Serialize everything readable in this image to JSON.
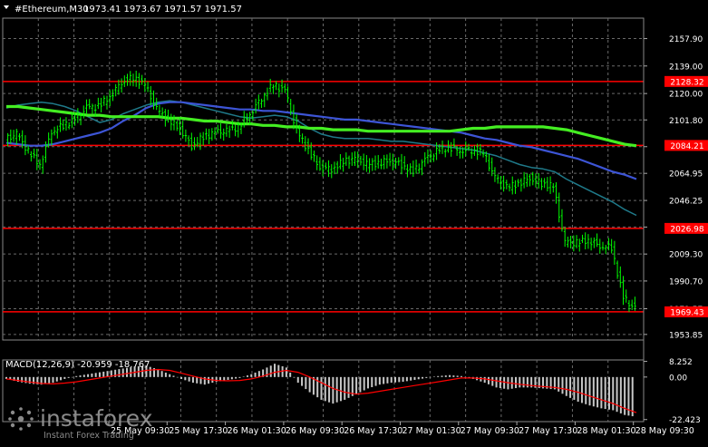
{
  "header": {
    "symbol": "#Ethereum,M30",
    "ohlc": "1973.41 1973.67 1971.57 1971.57"
  },
  "macd": {
    "label": "MACD(12,26,9) -20.959 -18.767",
    "axis_ticks": [
      "8.252",
      "0.00",
      "-22.423"
    ]
  },
  "watermark": {
    "brand": "instaforex",
    "tagline": "Instant Forex Trading"
  },
  "colors": {
    "background": "#000000",
    "grid": "#6a6a6a",
    "candle": "#00ff00",
    "level": "#ff0000",
    "ma_fast": "#1f7a8a",
    "ma_mid": "#3d55d6",
    "ma_slow": "#44ee22",
    "hist": "#c8c8c8",
    "signal": "#ff0000"
  },
  "chart_data": {
    "type": "line",
    "ylim": [
      1950.0,
      2172.0
    ],
    "y_ticks": [
      2157.9,
      2139.0,
      2120.0,
      2101.8,
      2083.35,
      2064.95,
      2046.25,
      2027.9,
      2009.3,
      1990.7,
      1971.57,
      1953.85
    ],
    "x_tick_labels": [
      "25 May 09:30",
      "25 May 17:30",
      "26 May 01:30",
      "26 May 09:30",
      "26 May 17:30",
      "27 May 01:30",
      "27 May 09:30",
      "27 May 17:30",
      "28 May 01:30",
      "28 May 09:30"
    ],
    "price_levels": [
      2128.32,
      2084.21,
      2026.98,
      1969.43
    ],
    "series": [
      {
        "values": [
          2088,
          2092,
          2080,
          2071,
          2094,
          2098,
          2102,
          2110,
          2111,
          2118,
          2128,
          2131,
          2126,
          2109,
          2102,
          2096,
          2084,
          2090,
          2093,
          2094,
          2097,
          2106,
          2117,
          2126,
          2122,
          2094,
          2081,
          2069,
          2068,
          2073,
          2075,
          2071,
          2072,
          2074,
          2071,
          2066,
          2074,
          2080,
          2083,
          2081,
          2081,
          2079,
          2062,
          2055,
          2058,
          2062,
          2058,
          2056,
          2017,
          2017,
          2019,
          2015,
          2014,
          1979,
          1971.57
        ]
      },
      {
        "values": [
          2110,
          2112,
          2113,
          2114,
          2113,
          2111,
          2108,
          2104,
          2100,
          2102,
          2106,
          2109,
          2112,
          2114,
          2115,
          2114,
          2112,
          2110,
          2108,
          2106,
          2104,
          2103,
          2104,
          2105,
          2104,
          2101,
          2096,
          2092,
          2090,
          2089,
          2089,
          2089,
          2088,
          2087,
          2087,
          2086,
          2085,
          2084,
          2083,
          2082,
          2081,
          2079,
          2077,
          2074,
          2071,
          2069,
          2068,
          2066,
          2061,
          2057,
          2053,
          2049,
          2045,
          2040,
          2036
        ]
      },
      {
        "values": [
          2086,
          2085,
          2084,
          2084,
          2085,
          2087,
          2089,
          2091,
          2093,
          2096,
          2101,
          2105,
          2110,
          2113,
          2114,
          2114,
          2113,
          2112,
          2111,
          2110,
          2109,
          2109,
          2108,
          2108,
          2107,
          2106,
          2105,
          2104,
          2103,
          2102,
          2102,
          2101,
          2100,
          2099,
          2098,
          2097,
          2096,
          2095,
          2094,
          2093,
          2091,
          2089,
          2088,
          2086,
          2084,
          2083,
          2081,
          2079,
          2077,
          2075,
          2072,
          2069,
          2066,
          2064,
          2061
        ]
      },
      {
        "values": [
          2111,
          2111,
          2110,
          2109,
          2108,
          2107,
          2106,
          2105,
          2105,
          2104,
          2104,
          2104,
          2104,
          2104,
          2103,
          2103,
          2102,
          2101,
          2101,
          2100,
          2099,
          2099,
          2098,
          2098,
          2097,
          2097,
          2096,
          2096,
          2095,
          2095,
          2095,
          2094,
          2094,
          2094,
          2094,
          2094,
          2094,
          2094,
          2094,
          2095,
          2096,
          2096,
          2097,
          2097,
          2097,
          2097,
          2097,
          2096,
          2095,
          2093,
          2091,
          2089,
          2087,
          2085,
          2084
        ]
      }
    ],
    "macd": {
      "ylim": [
        -23.5,
        9.0
      ],
      "histogram": [
        -1.0,
        -2.5,
        -3.5,
        -4.0,
        -3.0,
        -1.0,
        0.5,
        1.5,
        2.5,
        3.5,
        4.5,
        5.5,
        6.0,
        4.0,
        1.5,
        -1.0,
        -3.0,
        -4.0,
        -2.5,
        -1.5,
        -0.5,
        1.5,
        4.0,
        7.0,
        5.0,
        -3.0,
        -8.0,
        -12.0,
        -14.0,
        -12.0,
        -9.0,
        -6.0,
        -4.0,
        -3.0,
        -2.5,
        -1.5,
        -0.5,
        0.5,
        1.0,
        0.5,
        -1.0,
        -3.0,
        -5.5,
        -6.5,
        -5.5,
        -5.5,
        -6.0,
        -6.5,
        -10.0,
        -13.0,
        -15.0,
        -16.5,
        -17.5,
        -20.0,
        -21.0
      ],
      "signal": [
        -1.0,
        -1.8,
        -2.6,
        -3.4,
        -3.6,
        -3.2,
        -2.5,
        -1.5,
        -0.5,
        0.5,
        1.5,
        2.5,
        3.5,
        4.0,
        3.5,
        2.0,
        0.5,
        -1.0,
        -1.8,
        -2.0,
        -1.8,
        -1.0,
        0.5,
        2.5,
        3.5,
        2.5,
        0.0,
        -3.0,
        -6.0,
        -8.0,
        -9.0,
        -8.5,
        -7.5,
        -6.5,
        -5.5,
        -4.5,
        -3.5,
        -2.5,
        -1.5,
        -0.5,
        -0.5,
        -1.0,
        -2.0,
        -3.0,
        -3.8,
        -4.5,
        -5.0,
        -5.5,
        -6.5,
        -8.0,
        -10.0,
        -12.0,
        -14.0,
        -16.5,
        -18.767
      ]
    }
  }
}
